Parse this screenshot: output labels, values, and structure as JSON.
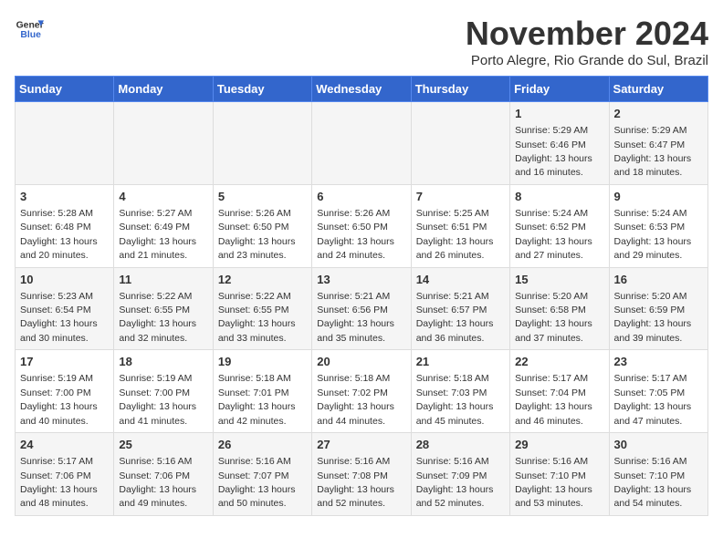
{
  "header": {
    "logo_line1": "General",
    "logo_line2": "Blue",
    "title": "November 2024",
    "subtitle": "Porto Alegre, Rio Grande do Sul, Brazil"
  },
  "days_of_week": [
    "Sunday",
    "Monday",
    "Tuesday",
    "Wednesday",
    "Thursday",
    "Friday",
    "Saturday"
  ],
  "weeks": [
    [
      {
        "day": "",
        "info": ""
      },
      {
        "day": "",
        "info": ""
      },
      {
        "day": "",
        "info": ""
      },
      {
        "day": "",
        "info": ""
      },
      {
        "day": "",
        "info": ""
      },
      {
        "day": "1",
        "info": "Sunrise: 5:29 AM\nSunset: 6:46 PM\nDaylight: 13 hours\nand 16 minutes."
      },
      {
        "day": "2",
        "info": "Sunrise: 5:29 AM\nSunset: 6:47 PM\nDaylight: 13 hours\nand 18 minutes."
      }
    ],
    [
      {
        "day": "3",
        "info": "Sunrise: 5:28 AM\nSunset: 6:48 PM\nDaylight: 13 hours\nand 20 minutes."
      },
      {
        "day": "4",
        "info": "Sunrise: 5:27 AM\nSunset: 6:49 PM\nDaylight: 13 hours\nand 21 minutes."
      },
      {
        "day": "5",
        "info": "Sunrise: 5:26 AM\nSunset: 6:50 PM\nDaylight: 13 hours\nand 23 minutes."
      },
      {
        "day": "6",
        "info": "Sunrise: 5:26 AM\nSunset: 6:50 PM\nDaylight: 13 hours\nand 24 minutes."
      },
      {
        "day": "7",
        "info": "Sunrise: 5:25 AM\nSunset: 6:51 PM\nDaylight: 13 hours\nand 26 minutes."
      },
      {
        "day": "8",
        "info": "Sunrise: 5:24 AM\nSunset: 6:52 PM\nDaylight: 13 hours\nand 27 minutes."
      },
      {
        "day": "9",
        "info": "Sunrise: 5:24 AM\nSunset: 6:53 PM\nDaylight: 13 hours\nand 29 minutes."
      }
    ],
    [
      {
        "day": "10",
        "info": "Sunrise: 5:23 AM\nSunset: 6:54 PM\nDaylight: 13 hours\nand 30 minutes."
      },
      {
        "day": "11",
        "info": "Sunrise: 5:22 AM\nSunset: 6:55 PM\nDaylight: 13 hours\nand 32 minutes."
      },
      {
        "day": "12",
        "info": "Sunrise: 5:22 AM\nSunset: 6:55 PM\nDaylight: 13 hours\nand 33 minutes."
      },
      {
        "day": "13",
        "info": "Sunrise: 5:21 AM\nSunset: 6:56 PM\nDaylight: 13 hours\nand 35 minutes."
      },
      {
        "day": "14",
        "info": "Sunrise: 5:21 AM\nSunset: 6:57 PM\nDaylight: 13 hours\nand 36 minutes."
      },
      {
        "day": "15",
        "info": "Sunrise: 5:20 AM\nSunset: 6:58 PM\nDaylight: 13 hours\nand 37 minutes."
      },
      {
        "day": "16",
        "info": "Sunrise: 5:20 AM\nSunset: 6:59 PM\nDaylight: 13 hours\nand 39 minutes."
      }
    ],
    [
      {
        "day": "17",
        "info": "Sunrise: 5:19 AM\nSunset: 7:00 PM\nDaylight: 13 hours\nand 40 minutes."
      },
      {
        "day": "18",
        "info": "Sunrise: 5:19 AM\nSunset: 7:00 PM\nDaylight: 13 hours\nand 41 minutes."
      },
      {
        "day": "19",
        "info": "Sunrise: 5:18 AM\nSunset: 7:01 PM\nDaylight: 13 hours\nand 42 minutes."
      },
      {
        "day": "20",
        "info": "Sunrise: 5:18 AM\nSunset: 7:02 PM\nDaylight: 13 hours\nand 44 minutes."
      },
      {
        "day": "21",
        "info": "Sunrise: 5:18 AM\nSunset: 7:03 PM\nDaylight: 13 hours\nand 45 minutes."
      },
      {
        "day": "22",
        "info": "Sunrise: 5:17 AM\nSunset: 7:04 PM\nDaylight: 13 hours\nand 46 minutes."
      },
      {
        "day": "23",
        "info": "Sunrise: 5:17 AM\nSunset: 7:05 PM\nDaylight: 13 hours\nand 47 minutes."
      }
    ],
    [
      {
        "day": "24",
        "info": "Sunrise: 5:17 AM\nSunset: 7:06 PM\nDaylight: 13 hours\nand 48 minutes."
      },
      {
        "day": "25",
        "info": "Sunrise: 5:16 AM\nSunset: 7:06 PM\nDaylight: 13 hours\nand 49 minutes."
      },
      {
        "day": "26",
        "info": "Sunrise: 5:16 AM\nSunset: 7:07 PM\nDaylight: 13 hours\nand 50 minutes."
      },
      {
        "day": "27",
        "info": "Sunrise: 5:16 AM\nSunset: 7:08 PM\nDaylight: 13 hours\nand 52 minutes."
      },
      {
        "day": "28",
        "info": "Sunrise: 5:16 AM\nSunset: 7:09 PM\nDaylight: 13 hours\nand 52 minutes."
      },
      {
        "day": "29",
        "info": "Sunrise: 5:16 AM\nSunset: 7:10 PM\nDaylight: 13 hours\nand 53 minutes."
      },
      {
        "day": "30",
        "info": "Sunrise: 5:16 AM\nSunset: 7:10 PM\nDaylight: 13 hours\nand 54 minutes."
      }
    ]
  ]
}
